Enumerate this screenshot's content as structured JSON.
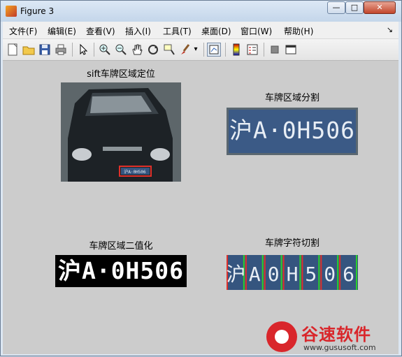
{
  "window": {
    "title": "Figure 3",
    "minimize": "—",
    "maximize": "□",
    "close": "✕"
  },
  "menubar": {
    "items": [
      "文件(F)",
      "编辑(E)",
      "查看(V)",
      "插入(I)",
      "工具(T)",
      "桌面(D)",
      "窗口(W)",
      "帮助(H)"
    ],
    "arrow": "↘"
  },
  "toolbar": {
    "icons": [
      "new-figure-icon",
      "open-file-icon",
      "save-icon",
      "print-icon",
      "pointer-icon",
      "zoom-in-icon",
      "zoom-out-icon",
      "pan-icon",
      "rotate-3d-icon",
      "data-cursor-icon",
      "brush-icon",
      "link-plot-icon",
      "colorbar-icon",
      "legend-icon",
      "hide-plot-tools-icon",
      "show-plot-tools-icon"
    ]
  },
  "axes": {
    "ax1_title": "sift车牌区域定位",
    "ax2_title": "车牌区域分割",
    "ax3_title": "车牌区域二值化",
    "ax4_title": "车牌字符切割"
  },
  "plates": {
    "segmented": "沪A·0H506",
    "binary": "沪A·0H506",
    "chars": [
      "沪",
      "A",
      "0",
      "H",
      "5",
      "0",
      "6"
    ],
    "small": "沪A·0H506"
  },
  "colors": {
    "figure_bg": "#cccccc",
    "plate_blue": "#3b5a86",
    "cut_red": "#e0302a",
    "cut_green": "#2bd02b",
    "watermark_red": "#d9262b"
  },
  "watermark": {
    "name": "谷速软件",
    "url": "www.gususoft.com"
  }
}
